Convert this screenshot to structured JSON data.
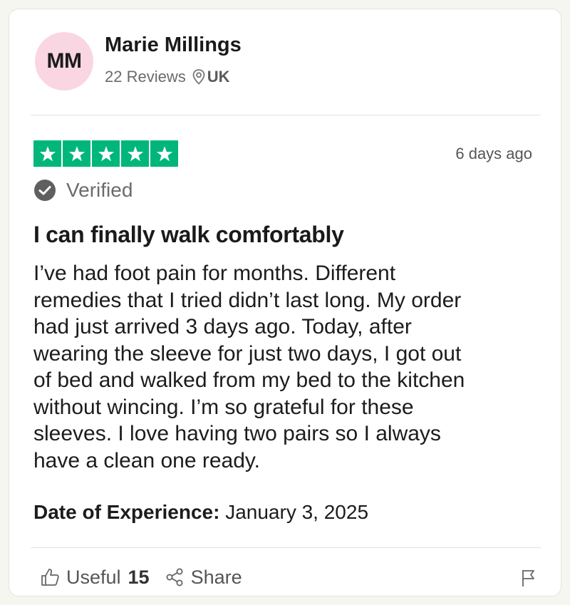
{
  "reviewer": {
    "initials": "MM",
    "name": "Marie Millings",
    "reviews": "22 Reviews",
    "country": "UK",
    "avatar_bg": "#f9d6e1"
  },
  "review": {
    "rating": 5,
    "rating_max": 5,
    "star_color": "#00b67a",
    "posted": "6 days ago",
    "verified_label": "Verified",
    "title": "I can finally walk comfortably",
    "lines": [
      "I’ve had foot pain for months. Different",
      "remedies that I tried didn’t last long. My order",
      "had just arrived 3 days ago. Today, after",
      "wearing the sleeve for just two days, I got out",
      "of bed and walked from my bed to the kitchen",
      "without wincing. I’m so grateful for these",
      "sleeves. I love having two pairs so I always",
      "have a clean one ready."
    ],
    "experience_label": "Date of Experience:",
    "experience_date": "January 3, 2025"
  },
  "actions": {
    "useful_label": "Useful",
    "useful_count": "15",
    "share_label": "Share",
    "icons": [
      "thumbs-up-icon",
      "share-icon",
      "flag-icon",
      "location-pin-icon",
      "check-circle-icon",
      "star-icon"
    ]
  }
}
